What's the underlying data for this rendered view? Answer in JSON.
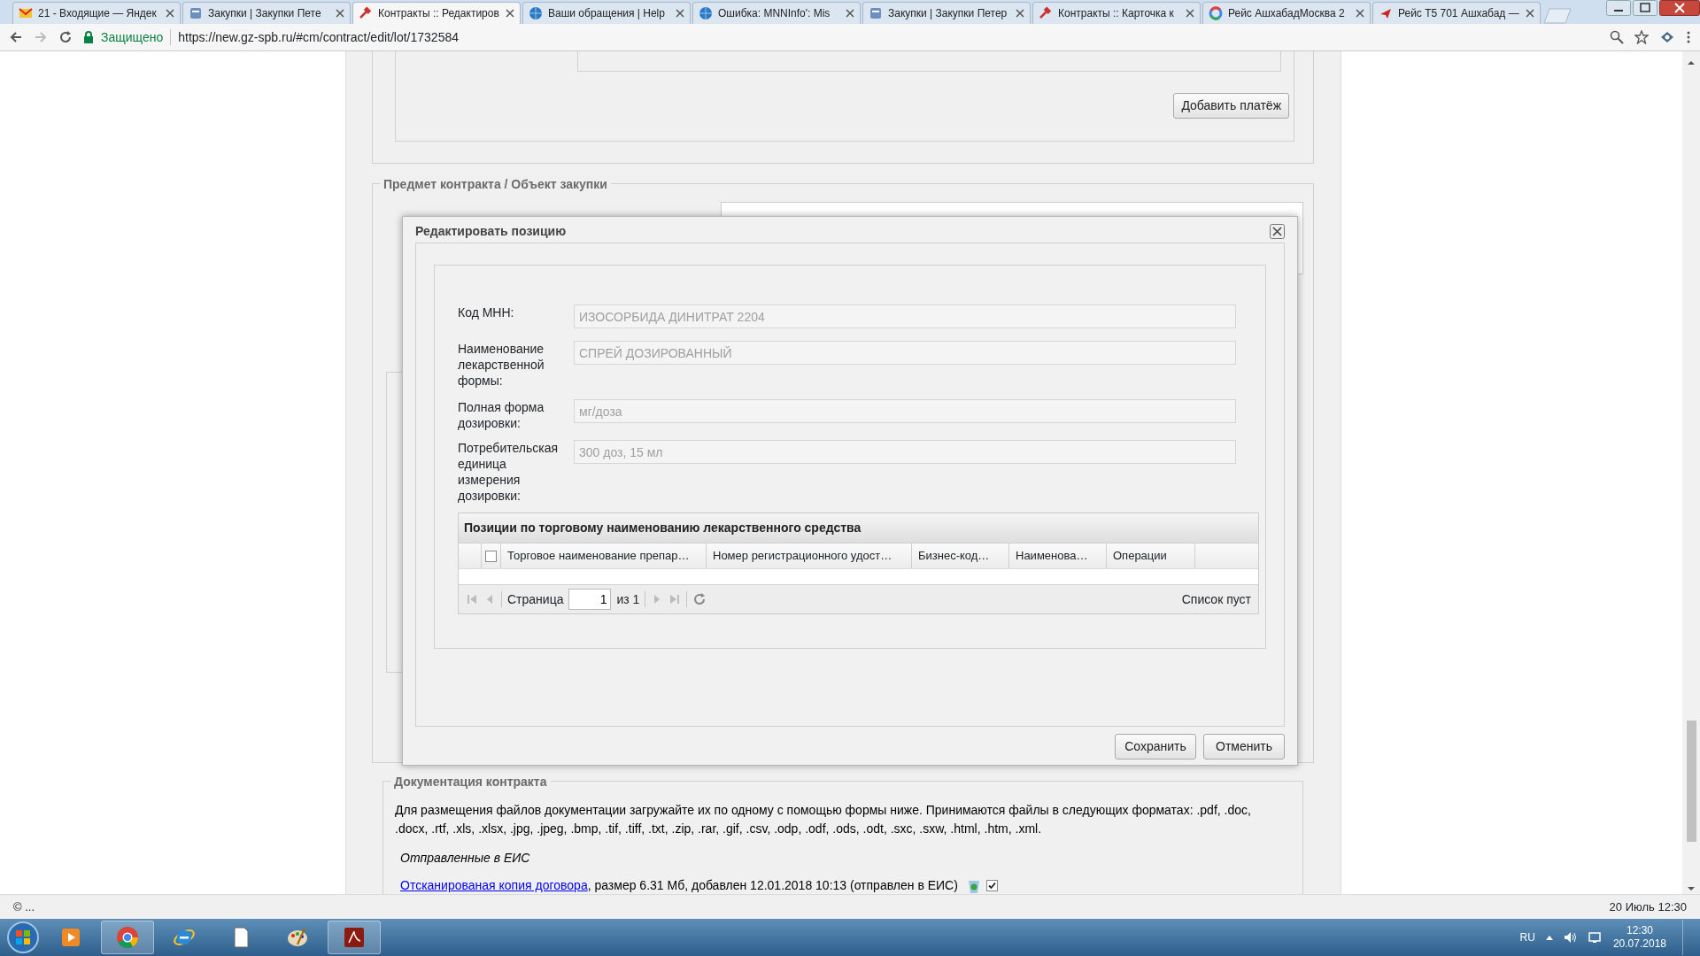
{
  "browser": {
    "tabs": [
      {
        "title": "21 - Входящие — Яндек",
        "kind": "mail",
        "selected": false
      },
      {
        "title": "Закупки | Закупки Пете",
        "kind": "site",
        "selected": false
      },
      {
        "title": "Контракты :: Редактиров",
        "kind": "tool",
        "selected": true
      },
      {
        "title": "Ваши обращения | Help",
        "kind": "globe",
        "selected": false
      },
      {
        "title": "Ошибка: MNNInfo': Mis",
        "kind": "globe",
        "selected": false
      },
      {
        "title": "Закупки | Закупки Петер",
        "kind": "site",
        "selected": false
      },
      {
        "title": "Контракты :: Карточка к",
        "kind": "tool",
        "selected": false
      },
      {
        "title": "Рейс АшхабадМосква 2",
        "kind": "google",
        "selected": false
      },
      {
        "title": "Рейс T5 701 Ашхабад —",
        "kind": "plane",
        "selected": false
      }
    ],
    "security": "Защищено",
    "url": "https://new.gz-spb.ru/#cm/contract/edit/lot/1732584"
  },
  "page": {
    "payment_button": "Добавить платёж",
    "subject_legend": "Предмет контракта / Объект закупки"
  },
  "dialog": {
    "title": "Редактировать позицию",
    "fields": [
      {
        "label": "Код МНН:",
        "value": "ИЗОСОРБИДА ДИНИТРАТ 2204",
        "disabled": true
      },
      {
        "label": "Наименование лекарственной формы:",
        "value": "СПРЕЙ ДОЗИРОВАННЫЙ",
        "disabled": true
      },
      {
        "label": "Полная форма дозировки:",
        "value": "мг/доза",
        "disabled": true
      },
      {
        "label": "Потребительская единица измерения дозировки:",
        "value": "300 доз, 15 мл",
        "disabled": true
      }
    ],
    "grid": {
      "title": "Позиции по торговому наименованию лекарственного средства",
      "select_all_checked": false,
      "columns": [
        "Торговое наименование препар…",
        "Номер регистрационного удост…",
        "Бизнес-код…",
        "Наименова…",
        "Операции"
      ],
      "pager": {
        "page_label": "Страница",
        "page": "1",
        "of": "из 1",
        "summary": "Список пуст"
      }
    },
    "buttons": [
      "Сохранить",
      "Отменить"
    ]
  },
  "documents": {
    "legend": "Документация контракта",
    "text": "Для размещения файлов документации загружайте их по одному с помощью формы ниже. Принимаются файлы в следующих форматах: .pdf, .doc, .docx, .rtf, .xls, .xlsx, .jpg, .jpeg, .bmp, .tif, .tiff, .txt, .zip, .rar, .gif, .csv, .odp, .odf, .ods, .odt, .sxc, .sxw, .html, .htm, .xml.",
    "sent_heading": "Отправленные в ЕИС",
    "files": [
      {
        "link": "Отсканированая копия договора",
        "info": ", размер 6.31 Мб, добавлен 12.01.2018 10:13 (отправлен в ЕИС)",
        "checked": true
      }
    ]
  },
  "status_bar": {
    "left": "© ...",
    "right": "20 Июль 12:30"
  },
  "taskbar": {
    "apps": [
      {
        "kind": "media",
        "selected": false
      },
      {
        "kind": "chrome",
        "selected": true
      },
      {
        "kind": "ie",
        "selected": false
      },
      {
        "kind": "file",
        "selected": false
      },
      {
        "kind": "paint",
        "selected": false
      },
      {
        "kind": "pdf",
        "selected": true
      }
    ],
    "language": "RU",
    "time": "12:30",
    "date": "20.07.2018"
  }
}
